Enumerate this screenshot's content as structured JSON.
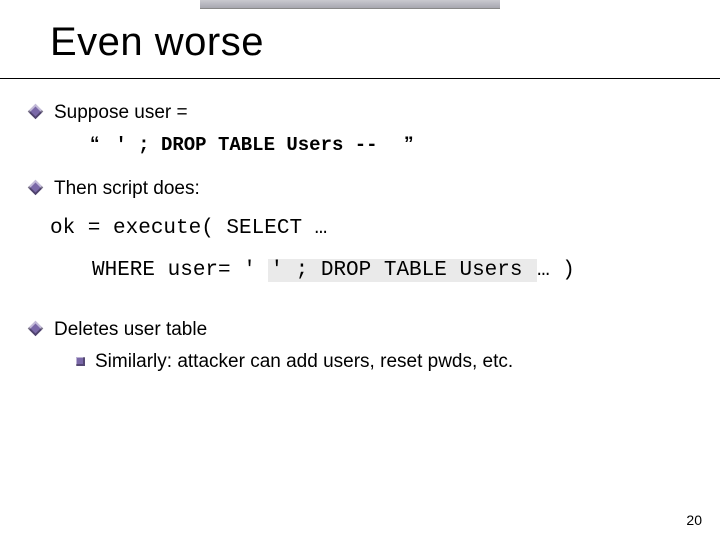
{
  "title": "Even worse",
  "bullets": {
    "b1": {
      "line1": "Suppose user =",
      "line2_open": "“",
      "line2_code": "′ ;  DROP TABLE  Users  --",
      "line2_close": "”"
    },
    "b2": {
      "text": "Then script does:"
    },
    "b3": {
      "text": "Deletes user table",
      "sub": "Similarly:   attacker can add users,  reset pwds,  etc."
    }
  },
  "code": {
    "line1": "ok = execute( SELECT …",
    "line2_prefix": "WHERE user= ′ ",
    "line2_hl": "′ ; DROP TABLE Users ",
    "line2_suffix": " …   )"
  },
  "page_number": "20"
}
